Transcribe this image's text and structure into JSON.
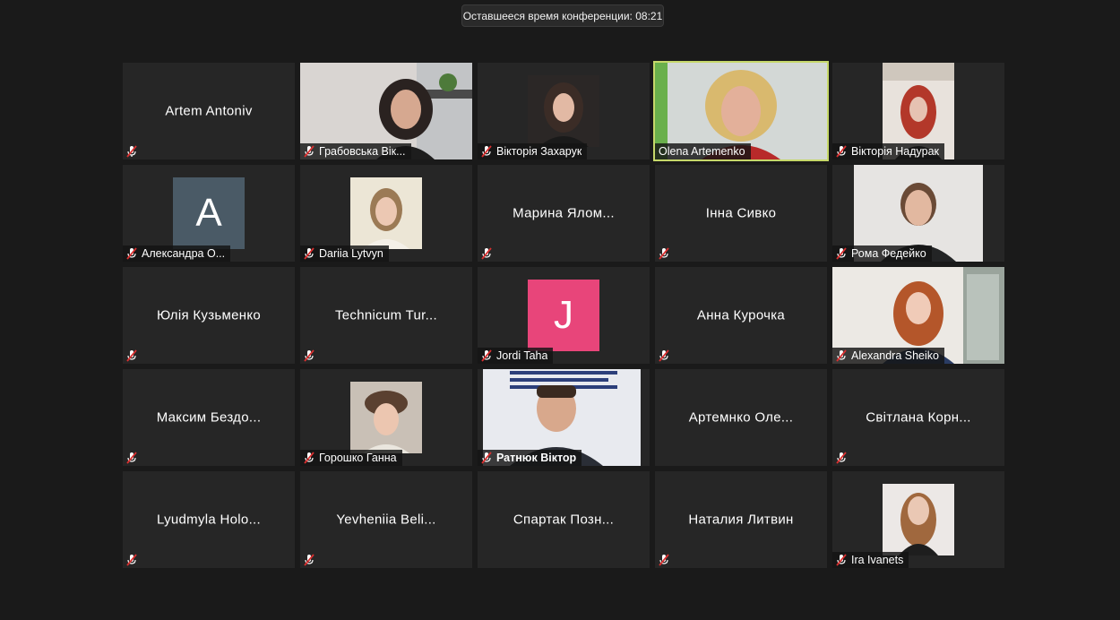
{
  "timer": {
    "text": "Оставшееся время конференции: 08:21"
  },
  "participants": [
    {
      "name": "Artem Antoniv",
      "type": "name"
    },
    {
      "name": "Грабовська Вік...",
      "type": "video"
    },
    {
      "name": "Вікторія Захарук",
      "type": "video"
    },
    {
      "name": "Olena Artemenko",
      "type": "video",
      "active": true
    },
    {
      "name": "Вікторія Надурак",
      "type": "video"
    },
    {
      "name": "Александра О...",
      "type": "avatar",
      "letter": "A",
      "color": "#4a5a66"
    },
    {
      "name": "Dariia Lytvyn",
      "type": "video"
    },
    {
      "name": "Марина  Ялом...",
      "type": "name"
    },
    {
      "name": "Інна Сивко",
      "type": "name"
    },
    {
      "name": "Рома Федейко",
      "type": "video"
    },
    {
      "name": "Юлія Кузьменко",
      "type": "name"
    },
    {
      "name": "Technicum  Tur...",
      "type": "name"
    },
    {
      "name": "Jordi Taha",
      "type": "avatar",
      "letter": "J",
      "color": "#e8457a"
    },
    {
      "name": "Анна Курочка",
      "type": "name"
    },
    {
      "name": "Alexandra Sheiko",
      "type": "video"
    },
    {
      "name": "Максим  Бездо...",
      "type": "name"
    },
    {
      "name": "Горошко Ганна",
      "type": "video"
    },
    {
      "name": "Ратнюк Віктор",
      "type": "video"
    },
    {
      "name": "Артемнко  Оле...",
      "type": "name"
    },
    {
      "name": "Світлана  Корн...",
      "type": "name"
    },
    {
      "name": "Lyudmyla  Holo...",
      "type": "name"
    },
    {
      "name": "Yevheniia  Beli...",
      "type": "name"
    },
    {
      "name": "Спартак  Позн...",
      "type": "name"
    },
    {
      "name": "Наталия Литвин",
      "type": "name"
    },
    {
      "name": "Ira Ivanets",
      "type": "video"
    }
  ],
  "icons": {
    "mute": "muted-microphone-icon"
  },
  "colors": {
    "background": "#1a1a1a",
    "tile": "#262626",
    "active_border": "#c6d86a",
    "mute_red": "#d93030"
  }
}
